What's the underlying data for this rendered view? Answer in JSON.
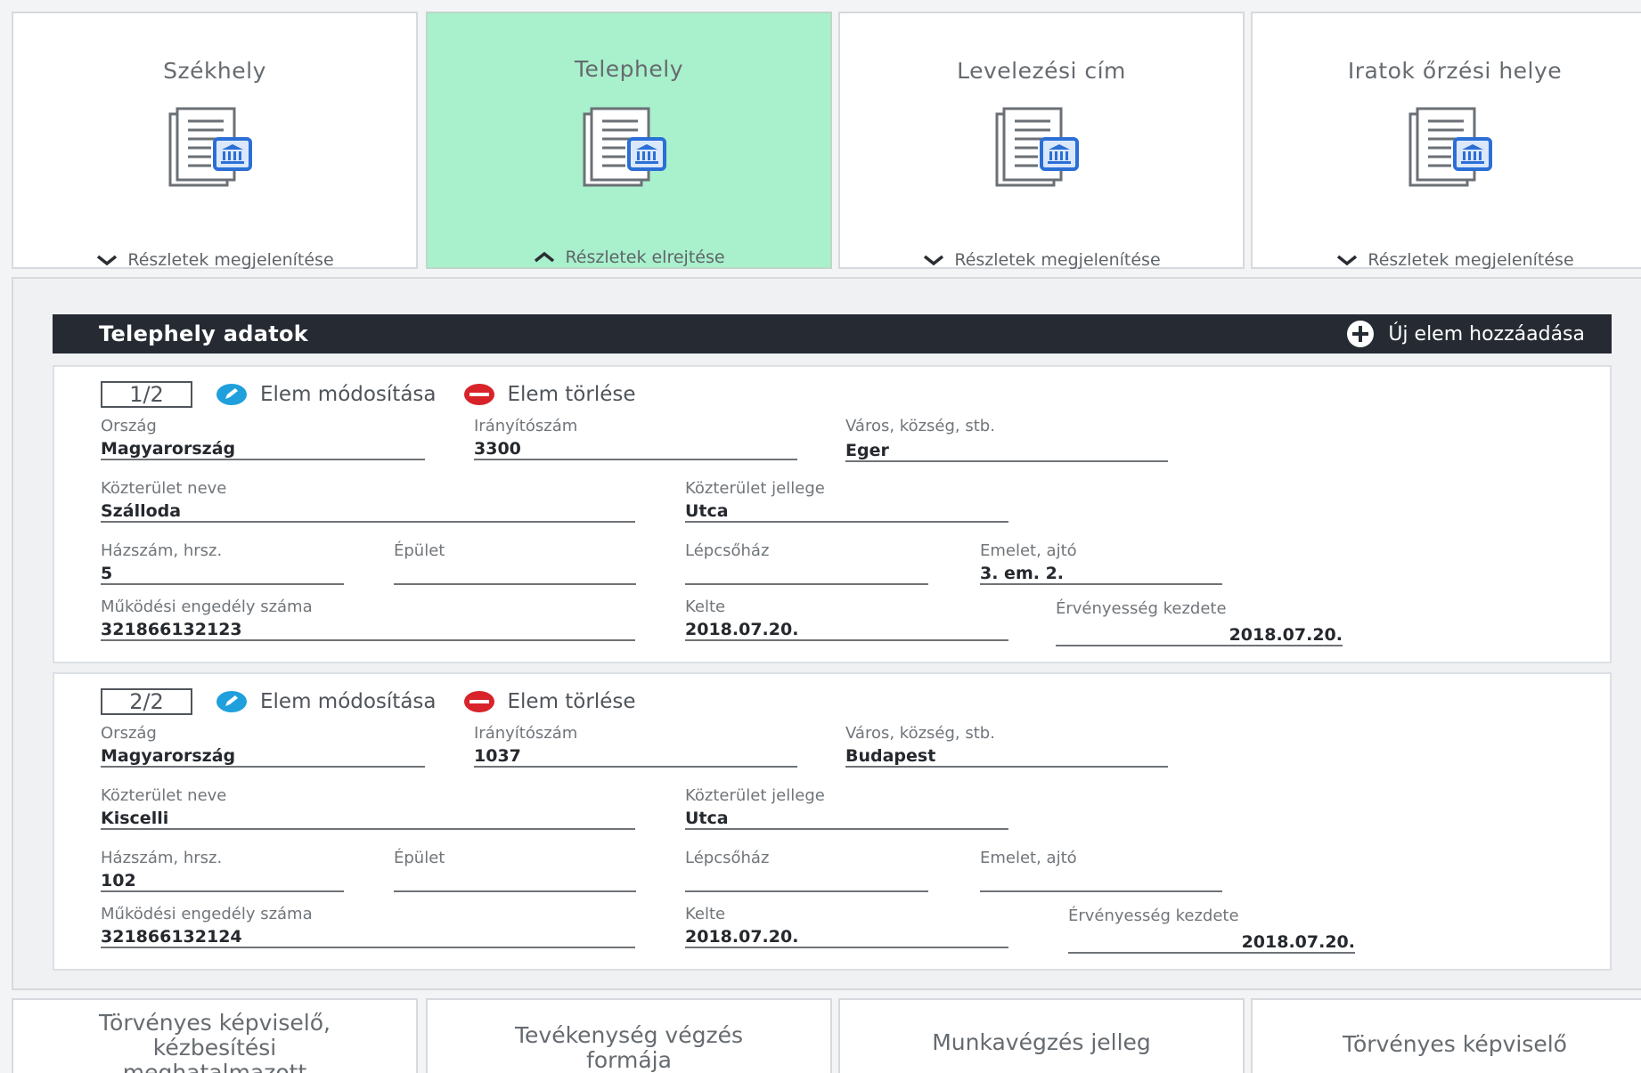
{
  "tiles": [
    {
      "title": "Székhely",
      "toggle": "Részletek megjelenítése",
      "active": false
    },
    {
      "title": "Telephely",
      "toggle": "Részletek elrejtése",
      "active": true
    },
    {
      "title": "Levelezési cím",
      "toggle": "Részletek megjelenítése",
      "active": false
    },
    {
      "title": "Iratok őrzési helye",
      "toggle": "Részletek megjelenítése",
      "active": false
    }
  ],
  "section": {
    "title": "Telephely adatok",
    "add_label": "Új elem hozzáadása"
  },
  "labels": {
    "edit": "Elem módosítása",
    "delete": "Elem törlése",
    "orszag": "Ország",
    "iranyitoszam": "Irányítószám",
    "varos": "Város, község, stb.",
    "kozterulet_neve": "Közterület neve",
    "kozterulet_jellege": "Közterület jellege",
    "hazszam": "Házszám, hrsz.",
    "epulet": "Épület",
    "lepcsohaz": "Lépcsőház",
    "emelet": "Emelet, ajtó",
    "engedely": "Működési engedély száma",
    "kelte": "Kelte",
    "ervenyesseg": "Érvényesség kezdete"
  },
  "records": [
    {
      "counter": "1/2",
      "orszag": "Magyarország",
      "iranyitoszam": "3300",
      "varos": "Eger",
      "kozterulet_neve": "Szálloda",
      "kozterulet_jellege": "Utca",
      "hazszam": "5",
      "epulet": "",
      "lepcsohaz": "",
      "emelet": "3. em. 2.",
      "engedely": "321866132123",
      "kelte": "2018.07.20.",
      "ervenyesseg": "2018.07.20."
    },
    {
      "counter": "2/2",
      "orszag": "Magyarország",
      "iranyitoszam": "1037",
      "varos": "Budapest",
      "kozterulet_neve": "Kiscelli",
      "kozterulet_jellege": "Utca",
      "hazszam": "102",
      "epulet": "",
      "lepcsohaz": "",
      "emelet": "",
      "engedely": "321866132124",
      "kelte": "2018.07.20.",
      "ervenyesseg": "2018.07.20."
    }
  ],
  "bottom_tiles": [
    {
      "line1": "Törvényes képviselő,",
      "line2": "kézbesítési",
      "line3": "meghatalmazott"
    },
    {
      "line1": "Tevékenység végzés",
      "line2": "formája",
      "line3": ""
    },
    {
      "line1": "Munkavégzés jelleg",
      "line2": "",
      "line3": ""
    },
    {
      "line1": "Törvényes képviselő",
      "line2": "",
      "line3": ""
    }
  ],
  "colors": {
    "active_tile": "#a9f0cc",
    "section_bar": "#262b33",
    "edit_icon": "#1fa0dc",
    "delete_icon": "#d8232a",
    "doc_badge": "#2b6fd6"
  },
  "icons": {
    "tile": "document-building-icon",
    "toggle_closed": "chevron-down-icon",
    "toggle_open": "chevron-up-icon",
    "add": "plus-circle-icon",
    "edit": "pencil-circle-icon",
    "delete": "minus-circle-icon"
  }
}
